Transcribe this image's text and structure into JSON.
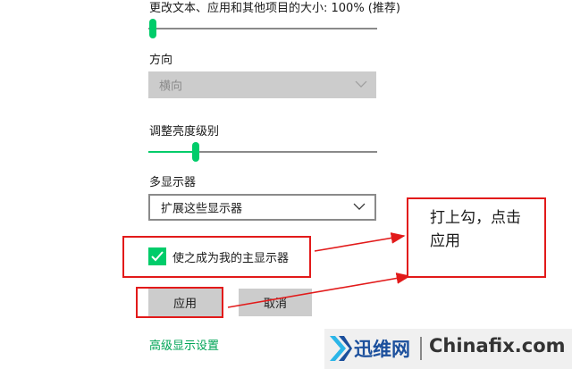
{
  "settings": {
    "scale_label": "更改文本、应用和其他项目的大小: 100% (推荐)",
    "scale_slider_percent": 0,
    "orientation_label": "方向",
    "orientation_value": "横向",
    "brightness_label": "调整亮度级别",
    "brightness_slider_percent": 20,
    "multi_display_label": "多显示器",
    "multi_display_value": "扩展这些显示器",
    "main_display_checkbox_label": "使之成为我的主显示器",
    "main_display_checked": true,
    "apply_button": "应用",
    "cancel_button": "取消",
    "advanced_link": "高级显示设置"
  },
  "annotation": {
    "note_line1": "打上勾，点击",
    "note_line2": "应用"
  },
  "watermark": {
    "brand": "迅维网",
    "site": "Chinafix.com"
  },
  "colors": {
    "accent": "#00cc6a",
    "link": "#00a457",
    "annotation_red": "#e21a1a"
  }
}
